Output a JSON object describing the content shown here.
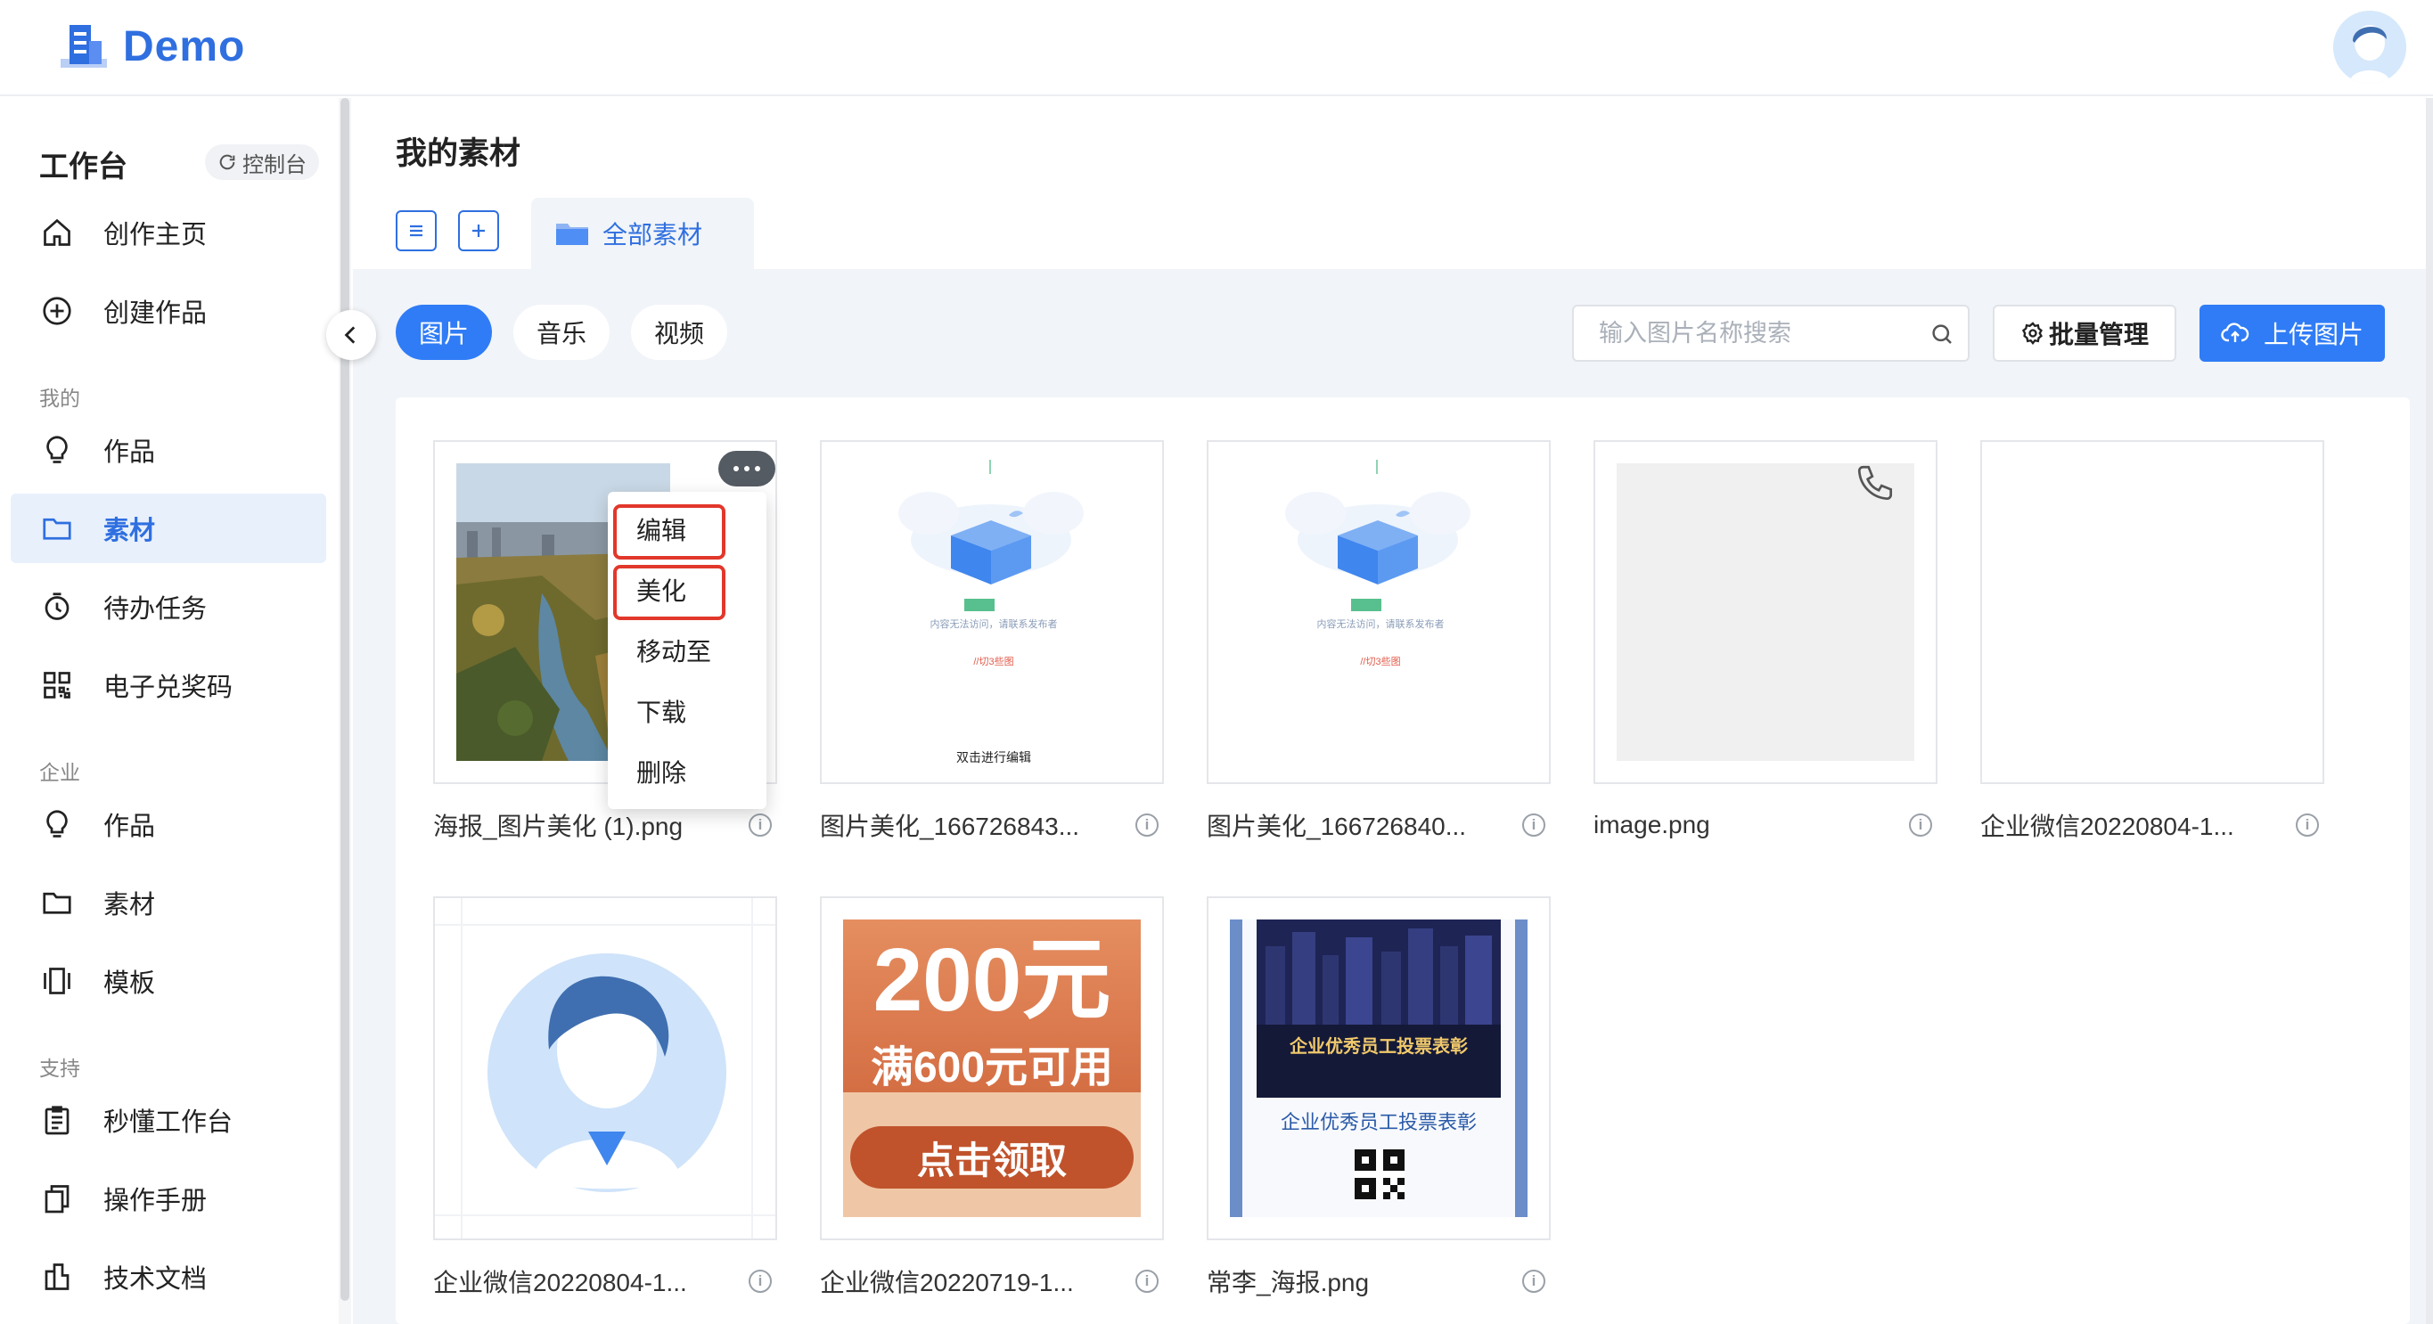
{
  "app": {
    "logo_text": "Demo"
  },
  "sidebar": {
    "title": "工作台",
    "console_label": "控制台",
    "items_top": [
      {
        "label": "创作主页",
        "icon": "home-icon"
      },
      {
        "label": "创建作品",
        "icon": "plus-circle-icon"
      }
    ],
    "group_mine": "我的",
    "items_mine": [
      {
        "label": "作品",
        "icon": "bulb-icon"
      },
      {
        "label": "素材",
        "icon": "folder-icon",
        "active": true
      },
      {
        "label": "待办任务",
        "icon": "timer-icon"
      },
      {
        "label": "电子兑奖码",
        "icon": "qrcode-icon"
      }
    ],
    "group_enterprise": "企业",
    "items_enterprise": [
      {
        "label": "作品",
        "icon": "bulb-icon"
      },
      {
        "label": "素材",
        "icon": "folder-icon"
      },
      {
        "label": "模板",
        "icon": "template-icon"
      }
    ],
    "group_support": "支持",
    "items_support": [
      {
        "label": "秒懂工作台",
        "icon": "clipboard-icon"
      },
      {
        "label": "操作手册",
        "icon": "manual-icon"
      },
      {
        "label": "技术文档",
        "icon": "doc-icon"
      }
    ]
  },
  "main": {
    "page_title": "我的素材",
    "folder_tab": "全部素材",
    "filters": [
      {
        "label": "图片",
        "active": true
      },
      {
        "label": "音乐",
        "active": false
      },
      {
        "label": "视频",
        "active": false
      }
    ],
    "search_placeholder": "输入图片名称搜索",
    "batch_label": "批量管理",
    "upload_label": "上传图片",
    "context_menu": [
      "编辑",
      "美化",
      "移动至",
      "下载",
      "删除"
    ],
    "assets": [
      {
        "name": "海报_图片美化 (1).png"
      },
      {
        "name": "图片美化_166726843...",
        "thumb_texts": [
          "内容无法访问，请联系发布者",
          "//切3些图",
          "双击进行编辑"
        ]
      },
      {
        "name": "图片美化_166726840...",
        "thumb_texts": [
          "内容无法访问，请联系发布者",
          "//切3些图"
        ]
      },
      {
        "name": "image.png"
      },
      {
        "name": "企业微信20220804-1..."
      },
      {
        "name": "企业微信20220804-1..."
      },
      {
        "name": "企业微信20220719-1...",
        "thumb_texts": [
          "200元",
          "满600元可用",
          "点击领取"
        ]
      },
      {
        "name": "常李_海报.png",
        "thumb_texts": [
          "企业优秀员工投票表彰",
          "企业优秀员工投票表彰"
        ]
      }
    ],
    "info_glyph": "i"
  },
  "colors": {
    "accent": "#2f7cf6",
    "highlight": "#e2372b"
  }
}
